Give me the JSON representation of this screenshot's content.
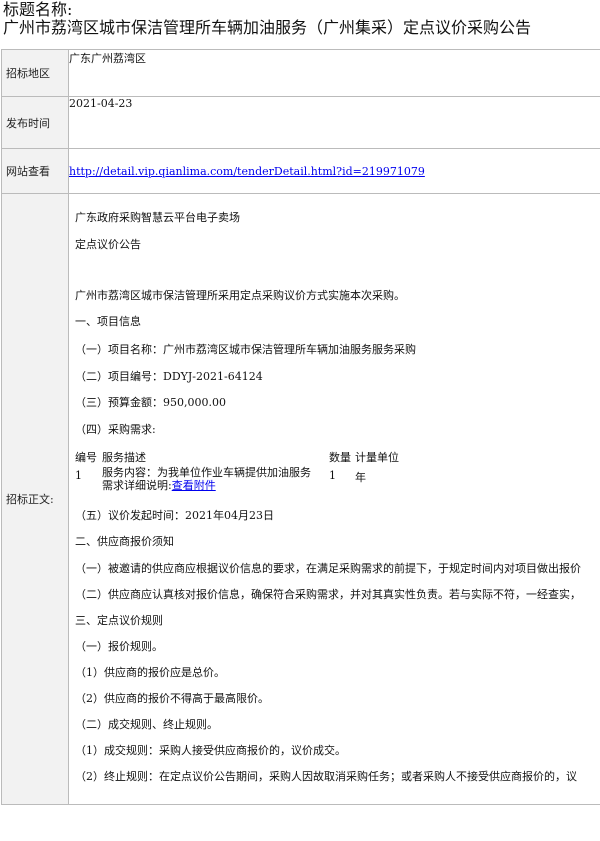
{
  "header": {
    "label": "标题名称:",
    "title": "广州市荔湾区城市保洁管理所车辆加油服务（广州集采）定点议价采购公告"
  },
  "rows": {
    "region": {
      "label": "招标地区",
      "value": "广东广州荔湾区"
    },
    "date": {
      "label": "发布时间",
      "value": "2021-04-23"
    },
    "site": {
      "label": "网站查看",
      "value": "http://detail.vip.qianlima.com/tenderDetail.html?id=219971079"
    },
    "body": {
      "label": "招标正文:"
    }
  },
  "content": {
    "platform": "广东政府采购智慧云平台电子卖场",
    "notice_type": "定点议价公告",
    "intro": "广州市荔湾区城市保洁管理所采用定点采购议价方式实施本次采购。",
    "s1": "一、项目信息",
    "s1_1": "（一）项目名称：广州市荔湾区城市保洁管理所车辆加油服务服务采购",
    "s1_2": "（二）项目编号：DDYJ-2021-64124",
    "s1_3": "（三）预算金额：950,000.00",
    "s1_4": "（四）采购需求:",
    "req_headers": {
      "no": "编号",
      "desc": "服务描述",
      "qty": "数量",
      "unit": "计量单位"
    },
    "req_row": {
      "no": "1",
      "desc_line1": "服务内容：为我单位作业车辆提供加油服务",
      "desc_line2_prefix": "需求详细说明:",
      "desc_link": "查看附件",
      "qty": "1",
      "unit": "年"
    },
    "s1_5": "（五）议价发起时间：2021年04月23日",
    "s2": "二、供应商报价须知",
    "s2_1": "（一）被邀请的供应商应根据议价信息的要求，在满足采购需求的前提下，于规定时间内对项目做出报价",
    "s2_2": "（二）供应商应认真核对报价信息，确保符合采购需求，并对其真实性负责。若与实际不符，一经查实，",
    "s3": "三、定点议价规则",
    "s3_1": "（一）报价规则。",
    "s3_1_1": "（1）供应商的报价应是总价。",
    "s3_1_2": "（2）供应商的报价不得高于最高限价。",
    "s3_2": "（二）成交规则、终止规则。",
    "s3_2_1": "（1）成交规则：采购人接受供应商报价的，议价成交。",
    "s3_2_2": "（2）终止规则：在定点议价公告期间，采购人因故取消采购任务；或者采购人不接受供应商报价的，议"
  }
}
